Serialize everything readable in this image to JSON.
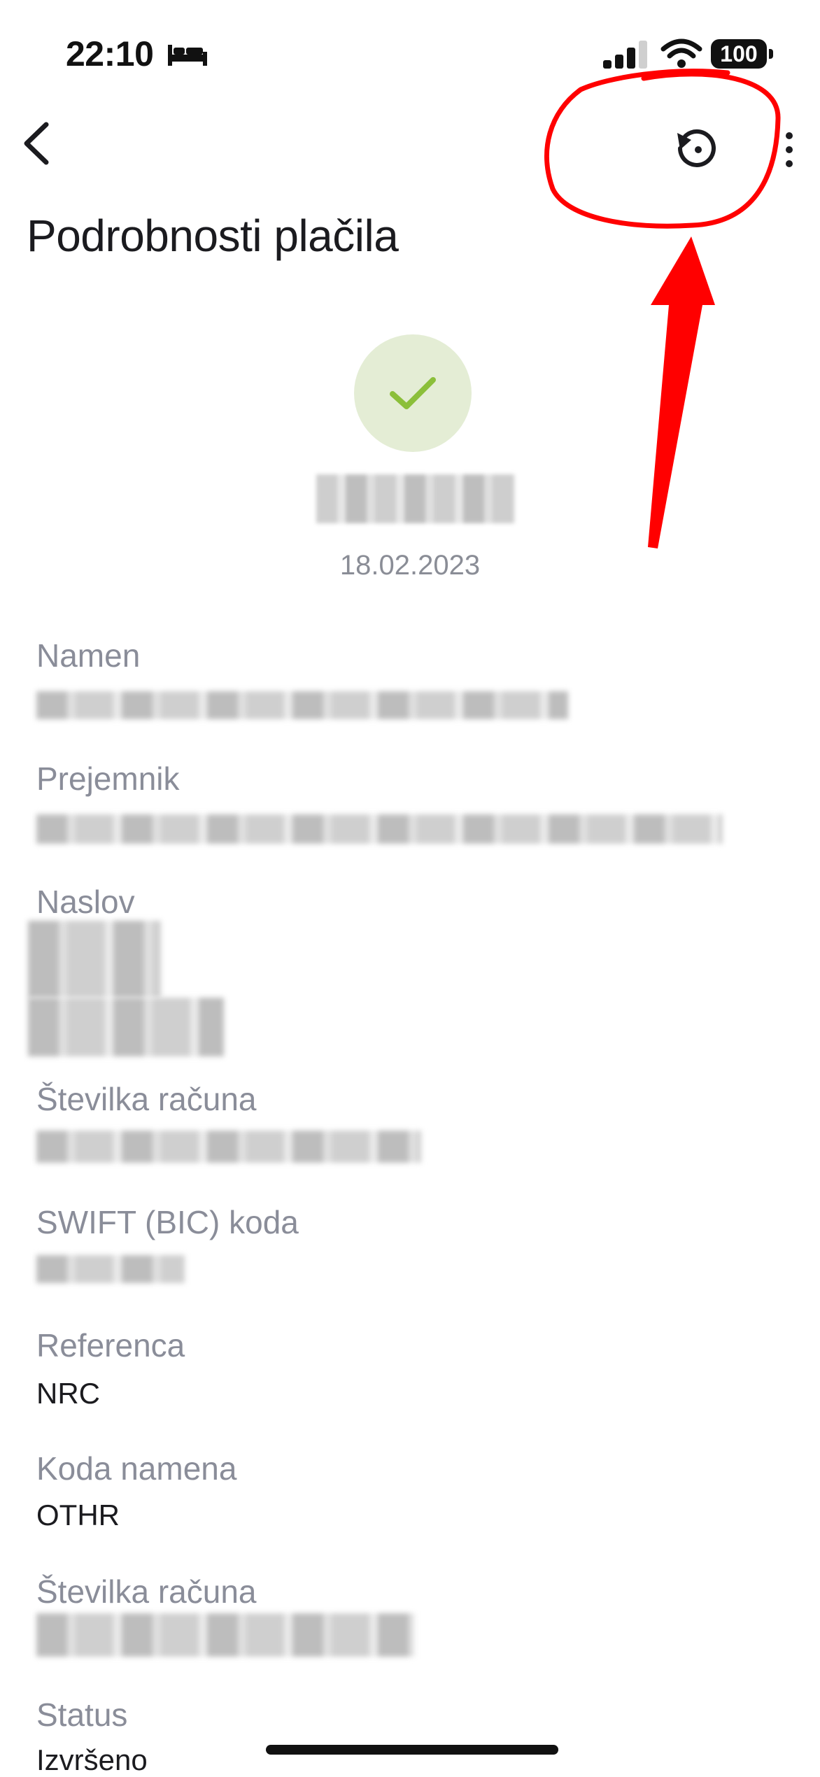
{
  "status_bar": {
    "time": "22:10",
    "battery": "100"
  },
  "header": {
    "title": "Podrobnosti plačila"
  },
  "summary": {
    "date": "18.02.2023"
  },
  "details": {
    "namen_label": "Namen",
    "prejemnik_label": "Prejemnik",
    "naslov_label": "Naslov",
    "stevilka_racuna_label": "Številka računa",
    "swift_label": "SWIFT (BIC) koda",
    "referenca_label": "Referenca",
    "referenca_value": "NRC",
    "koda_namena_label": "Koda namena",
    "koda_namena_value": "OTHR",
    "stevilka_racuna2_label": "Številka računa",
    "status_label": "Status",
    "status_value": "Izvršeno"
  },
  "icons": [
    "bed-icon",
    "signal-icon",
    "wifi-icon",
    "back-icon",
    "history-icon",
    "more-icon",
    "check-icon"
  ],
  "colors": {
    "success_bg": "#e4edd5",
    "success_check": "#8bbf3a",
    "annotation": "#ff0000"
  }
}
